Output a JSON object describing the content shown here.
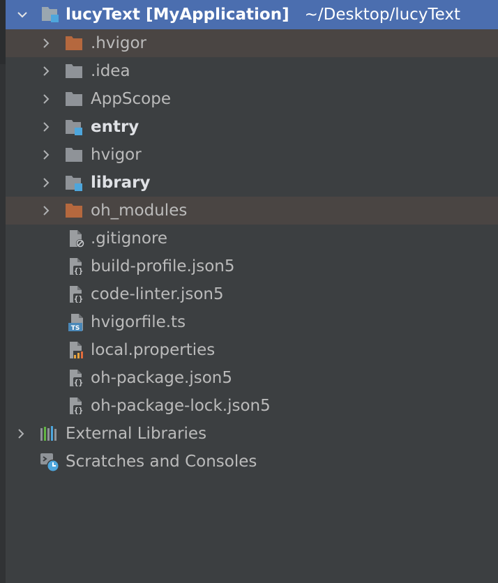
{
  "root": {
    "name": "lucyText",
    "module": "[MyApplication]",
    "path": "~/Desktop/lucyText"
  },
  "folders": [
    {
      "label": ".hvigor",
      "kind": "excluded"
    },
    {
      "label": ".idea",
      "kind": "plain"
    },
    {
      "label": "AppScope",
      "kind": "plain"
    },
    {
      "label": "entry",
      "kind": "module"
    },
    {
      "label": "hvigor",
      "kind": "plain"
    },
    {
      "label": "library",
      "kind": "module"
    },
    {
      "label": "oh_modules",
      "kind": "excluded"
    }
  ],
  "files": [
    {
      "label": ".gitignore",
      "icon": "ignore-file-icon"
    },
    {
      "label": "build-profile.json5",
      "icon": "json-file-icon"
    },
    {
      "label": "code-linter.json5",
      "icon": "json-file-icon"
    },
    {
      "label": "hvigorfile.ts",
      "icon": "typescript-file-icon"
    },
    {
      "label": "local.properties",
      "icon": "properties-file-icon"
    },
    {
      "label": "oh-package.json5",
      "icon": "json-file-icon"
    },
    {
      "label": "oh-package-lock.json5",
      "icon": "json-file-icon"
    }
  ],
  "bottom": {
    "external_libraries": "External Libraries",
    "scratches": "Scratches and Consoles"
  },
  "colors": {
    "background": "#3c3f41",
    "selection": "#4b6eaf",
    "excluded_row": "#4a4543",
    "excluded_folder": "#b5683e",
    "folder": "#8f9398",
    "module_badge": "#4ea6dc"
  }
}
